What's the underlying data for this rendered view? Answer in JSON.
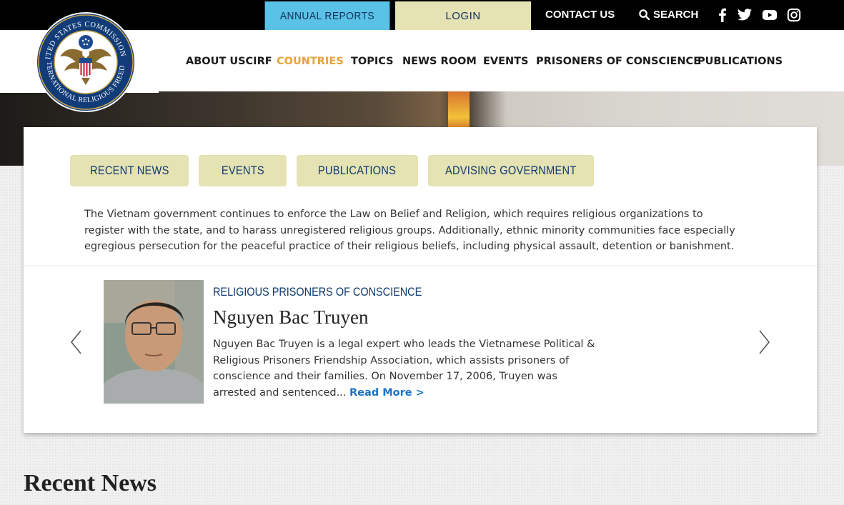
{
  "topbar": {
    "annual_reports": "ANNUAL REPORTS",
    "login": "LOGIN",
    "contact_us": "CONTACT US",
    "search": "SEARCH",
    "social": [
      "facebook-icon",
      "twitter-icon",
      "youtube-icon",
      "instagram-icon"
    ]
  },
  "logo": {
    "ring_text_top": "United States Commission on",
    "ring_text_bottom": "International Religious Freedom"
  },
  "nav": {
    "items": [
      "ABOUT USCIRF",
      "COUNTRIES",
      "TOPICS",
      "NEWS ROOM",
      "EVENTS",
      "PRISONERS OF CONSCIENCE",
      "PUBLICATIONS"
    ],
    "active": "COUNTRIES"
  },
  "tabs": [
    "RECENT NEWS",
    "EVENTS",
    "PUBLICATIONS",
    "ADVISING GOVERNMENT"
  ],
  "intro": "The Vietnam government continues to enforce the Law on Belief and Religion, which requires religious organizations to register with the state, and to harass unregistered religious groups. Additionally, ethnic minority communities face especially egregious persecution for the peaceful practice of their religious beliefs, including physical assault, detention or banishment.",
  "feature": {
    "eyebrow": "RELIGIOUS PRISONERS OF CONSCIENCE",
    "name": "Nguyen Bac Truyen",
    "bio": "Nguyen Bac Truyen is a legal expert who leads the Vietnamese Political & Religious Prisoners Friendship Association, which assists prisoners of conscience and their families. On November 17, 2006, Truyen was arrested and sentenced...",
    "read_more": "Read More >"
  },
  "recent_heading": "Recent News",
  "colors": {
    "accent_blue": "#5bc2e7",
    "accent_beige": "#e5e2b4",
    "active_orange": "#e9a23b",
    "navy": "#0e3a6e"
  }
}
